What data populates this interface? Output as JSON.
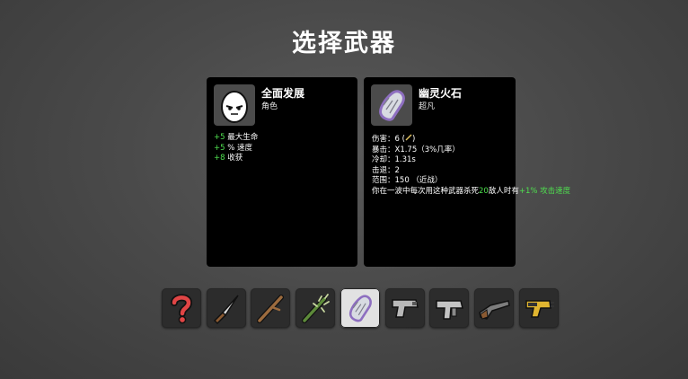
{
  "title": "选择武器",
  "character": {
    "name": "全面发展",
    "type": "角色",
    "icon": "egg-face-icon",
    "stats": [
      {
        "value": "+5",
        "label": "最大生命"
      },
      {
        "value": "+5",
        "label": "% 速度"
      },
      {
        "value": "+8",
        "label": "收获"
      }
    ]
  },
  "weapon": {
    "name": "幽灵火石",
    "tier": "超凡",
    "icon": "ghost-flint-icon",
    "damage_label": "伤害：",
    "damage_value": "6 (",
    "damage_suffix": ")",
    "crit": "暴击：X1.75（3%几率）",
    "cooldown": "冷却：1.31s",
    "knockback": "击退：2",
    "range": "范围：150 （近战）",
    "effect_prefix": "你在一波中每次用这种武器杀死",
    "effect_kills": "20",
    "effect_mid": "敌人时有",
    "effect_bonus": "+1% 攻击速度"
  },
  "weapon_slots": [
    {
      "icon": "random-question-icon"
    },
    {
      "icon": "knife-icon"
    },
    {
      "icon": "stick-icon"
    },
    {
      "icon": "spiky-stick-icon"
    },
    {
      "icon": "ghost-flint-icon",
      "selected": true
    },
    {
      "icon": "pistol-icon"
    },
    {
      "icon": "smg-icon"
    },
    {
      "icon": "shotgun-icon"
    },
    {
      "icon": "taser-icon"
    }
  ],
  "colors": {
    "background": "#4a4a4a",
    "panel": "#000000",
    "stat_green": "#4fe04f",
    "selected_slot": "#e2e2e2",
    "slot": "#2c2c2c",
    "flint_purple": "#9a7fc4"
  }
}
